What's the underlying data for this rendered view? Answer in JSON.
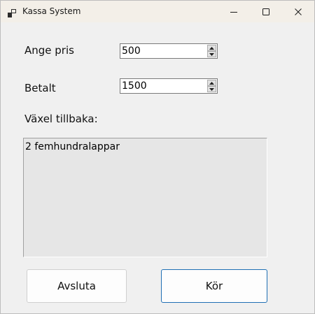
{
  "window": {
    "title": "Kassa System"
  },
  "form": {
    "price_label": "Ange pris",
    "price_value": "500",
    "paid_label": "Betalt",
    "paid_value": "1500",
    "change_label": "Växel tillbaka:",
    "change_output": "2 femhundralappar"
  },
  "buttons": {
    "quit_label": "Avsluta",
    "run_label": "Kör"
  },
  "icons": {
    "app": "app-icon",
    "minimize": "minimize-icon",
    "maximize": "maximize-icon",
    "close": "close-icon",
    "spin_up": "chevron-up-icon",
    "spin_down": "chevron-down-icon"
  },
  "colors": {
    "titlebar": "#f3efe8",
    "window_bg": "#f0f0f0",
    "output_bg": "#e6e6e6",
    "default_button_border": "#1f6fb4"
  }
}
